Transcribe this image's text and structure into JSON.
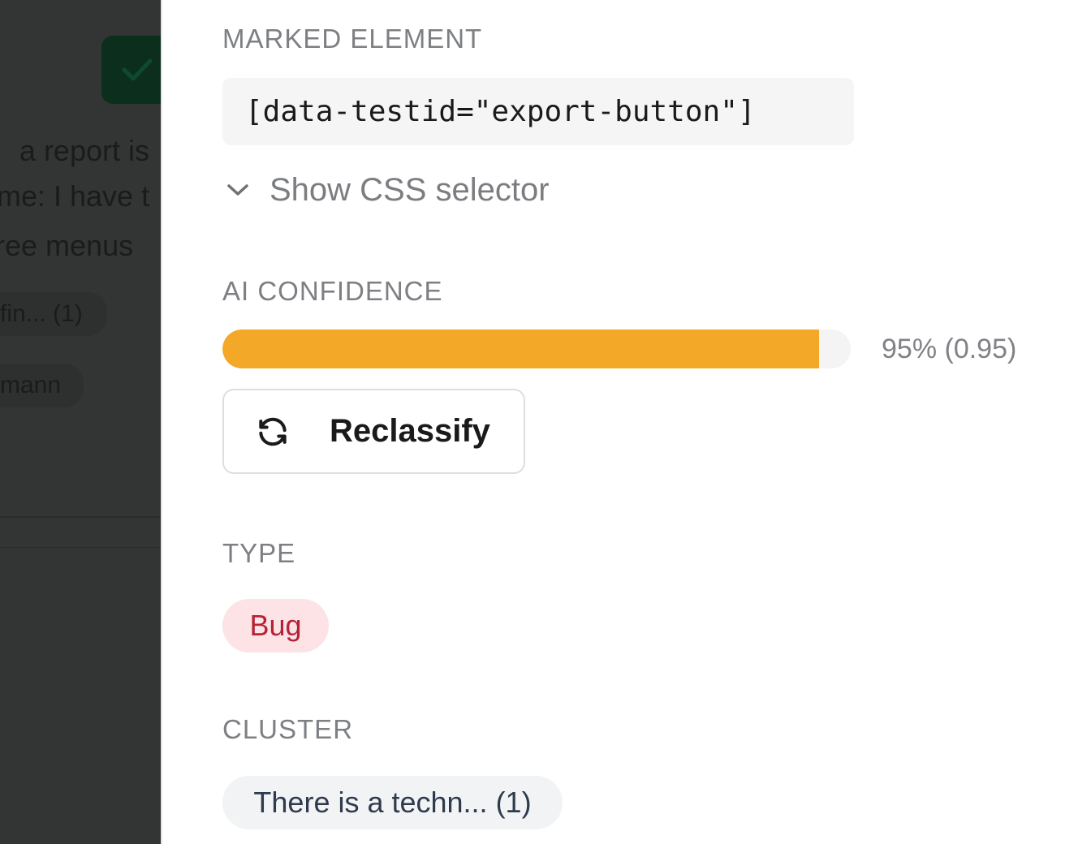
{
  "background_page": {
    "text_lines": [
      "a report is",
      "me: I have t",
      "ree menus"
    ],
    "chips": [
      "fin... (1)",
      "mann"
    ]
  },
  "panel": {
    "marked_element": {
      "label": "MARKED ELEMENT",
      "selector": "[data-testid=\"export-button\"]",
      "toggle_label": "Show CSS selector",
      "toggle_icon": "chevron-down-icon"
    },
    "ai_confidence": {
      "label": "AI CONFIDENCE",
      "value": 0.95,
      "value_text": "95% (0.95)",
      "bar_color": "#f4a828",
      "reclassify_label": "Reclassify",
      "reclassify_icon": "refresh-icon"
    },
    "type": {
      "label": "TYPE",
      "value": "Bug",
      "badge_color": "#b42336"
    },
    "cluster": {
      "label": "CLUSTER",
      "value": "There is a techn... (1)"
    }
  }
}
